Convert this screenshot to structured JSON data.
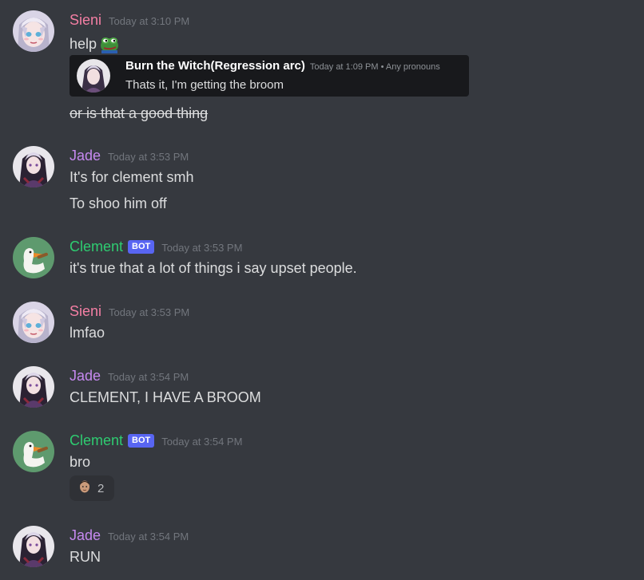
{
  "messages": [
    {
      "author": "Sieni",
      "timestamp": "Today at 3:10 PM",
      "lines": [
        "help",
        "or is that a good thing"
      ],
      "emoji": "pepe-emoji",
      "embed": {
        "author": "Burn the Witch(Regression arc)",
        "meta": "Today at 1:09 PM • Any pronouns",
        "text": "Thats it, I'm getting the broom"
      }
    },
    {
      "author": "Jade",
      "timestamp": "Today at 3:53 PM",
      "lines": [
        "It's for clement smh",
        "To shoo him off"
      ]
    },
    {
      "author": "Clement",
      "bot_tag": "BOT",
      "timestamp": "Today at 3:53 PM",
      "lines": [
        "it's true that a lot of things i say upset people."
      ]
    },
    {
      "author": "Sieni",
      "timestamp": "Today at 3:53 PM",
      "lines": [
        "lmfao"
      ]
    },
    {
      "author": "Jade",
      "timestamp": "Today at 3:54 PM",
      "lines": [
        "CLEMENT, I HAVE A BROOM"
      ]
    },
    {
      "author": "Clement",
      "bot_tag": "BOT",
      "timestamp": "Today at 3:54 PM",
      "lines": [
        "bro"
      ],
      "reaction": {
        "emoji": "face-emoji",
        "count": "2"
      }
    },
    {
      "author": "Jade",
      "timestamp": "Today at 3:54 PM",
      "lines": [
        "RUN"
      ]
    }
  ],
  "colors": {
    "background": "#36393f",
    "sieni": "#f47fa4",
    "jade": "#c689f0",
    "clement": "#2ecc71",
    "bot_tag": "#5865f2",
    "timestamp": "#72767d",
    "text": "#dcddde",
    "embed_bg": "#18191c",
    "reaction_bg": "#2f3136"
  },
  "icons": {
    "sieni_avatar": "anime-girl-avatar-icon",
    "jade_avatar": "anime-girl-avatar-icon",
    "clement_avatar": "goose-avatar-icon",
    "embed_avatar": "anime-character-avatar-icon"
  }
}
